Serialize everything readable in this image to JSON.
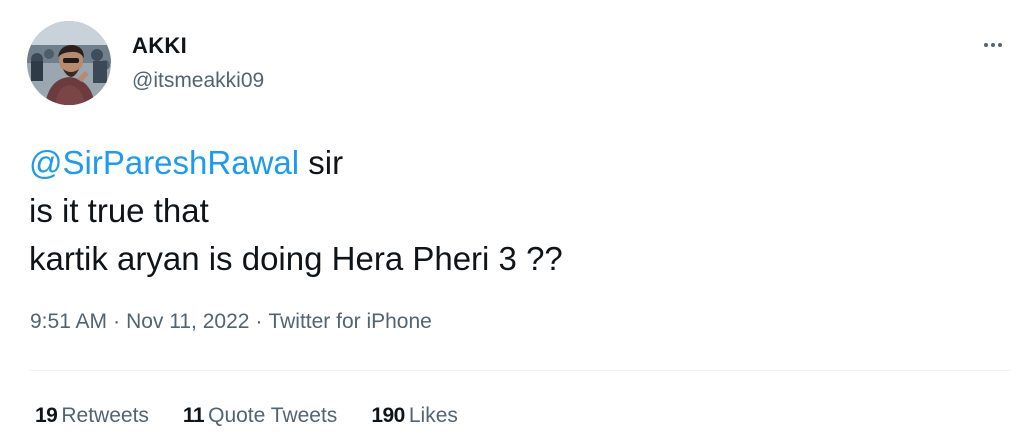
{
  "author": {
    "name": "AKKI",
    "handle": "@itsmeakki09"
  },
  "tweet": {
    "mention": "@SirPareshRawal",
    "line1_rest": " sir",
    "line2": "is it true that",
    "line3": "kartik aryan is doing Hera Pheri 3 ??"
  },
  "meta": {
    "time": "9:51 AM",
    "separator": "·",
    "date": "Nov 11, 2022",
    "source": "Twitter for iPhone"
  },
  "stats": {
    "retweets_count": "19",
    "retweets_label": "Retweets",
    "quotes_count": "11",
    "quotes_label": "Quote Tweets",
    "likes_count": "190",
    "likes_label": "Likes"
  },
  "colors": {
    "accent": "#1d9bf0",
    "text": "#0f1419",
    "secondary": "#536471",
    "divider": "#eff3f4"
  },
  "icons": {
    "more": "more-horizontal-icon"
  }
}
